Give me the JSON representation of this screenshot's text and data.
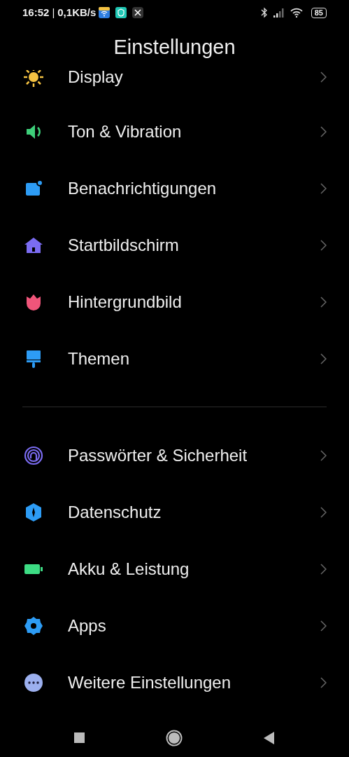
{
  "status_bar": {
    "time": "16:52",
    "divider": "|",
    "speed": "0,1KB/s",
    "battery": "85"
  },
  "title": "Einstellungen",
  "groups": [
    {
      "items": [
        {
          "label": "Display",
          "color": "#f5c242"
        },
        {
          "label": "Ton & Vibration",
          "color": "#3ecf7a"
        },
        {
          "label": "Benachrichtigungen",
          "color": "#2d9cf5"
        },
        {
          "label": "Startbildschirm",
          "color": "#7b6cf2"
        },
        {
          "label": "Hintergrundbild",
          "color": "#f0557a"
        },
        {
          "label": "Themen",
          "color": "#2d9cf5"
        }
      ]
    },
    {
      "items": [
        {
          "label": "Passwörter & Sicherheit",
          "color": "#7b6cf2"
        },
        {
          "label": "Datenschutz",
          "color": "#2d9cf5"
        },
        {
          "label": "Akku & Leistung",
          "color": "#3ddc84"
        },
        {
          "label": "Apps",
          "color": "#2d9cf5"
        },
        {
          "label": "Weitere Einstellungen",
          "color": "#9cb0ef"
        }
      ]
    }
  ]
}
